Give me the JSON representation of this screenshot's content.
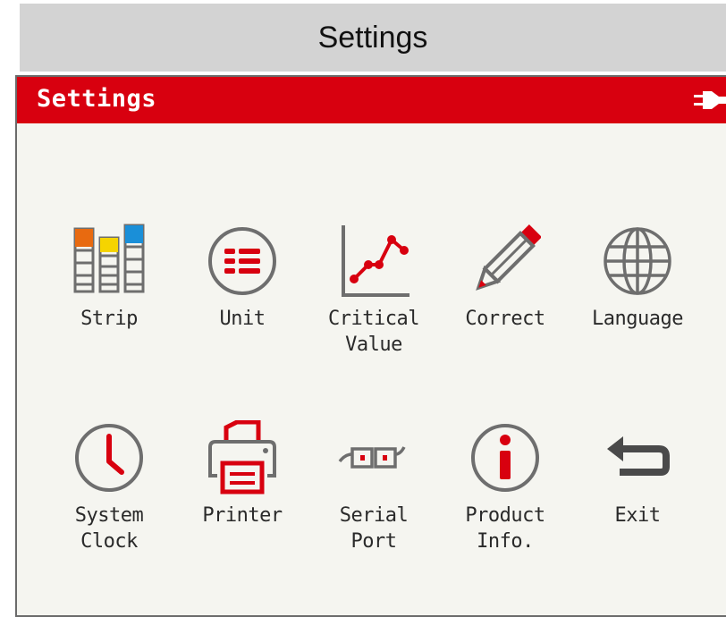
{
  "caption": "Settings",
  "window": {
    "title": "Settings"
  },
  "menu": {
    "strip": "Strip",
    "unit": "Unit",
    "critical_value": "Critical\nValue",
    "correct": "Correct",
    "language": "Language",
    "system_clock": "System\nClock",
    "printer": "Printer",
    "serial_port": "Serial\nPort",
    "product_info": "Product\nInfo.",
    "exit": "Exit"
  },
  "colors": {
    "accent": "#d8000f",
    "icon_gray": "#6e6e6e",
    "strip_orange": "#e86a10",
    "strip_yellow": "#f5d400",
    "strip_blue": "#1a8fd8"
  },
  "icons": [
    "strip-icon",
    "unit-icon",
    "critical-value-icon",
    "correct-icon",
    "language-icon",
    "clock-icon",
    "printer-icon",
    "serial-port-icon",
    "info-icon",
    "exit-icon",
    "power-plug-icon"
  ]
}
